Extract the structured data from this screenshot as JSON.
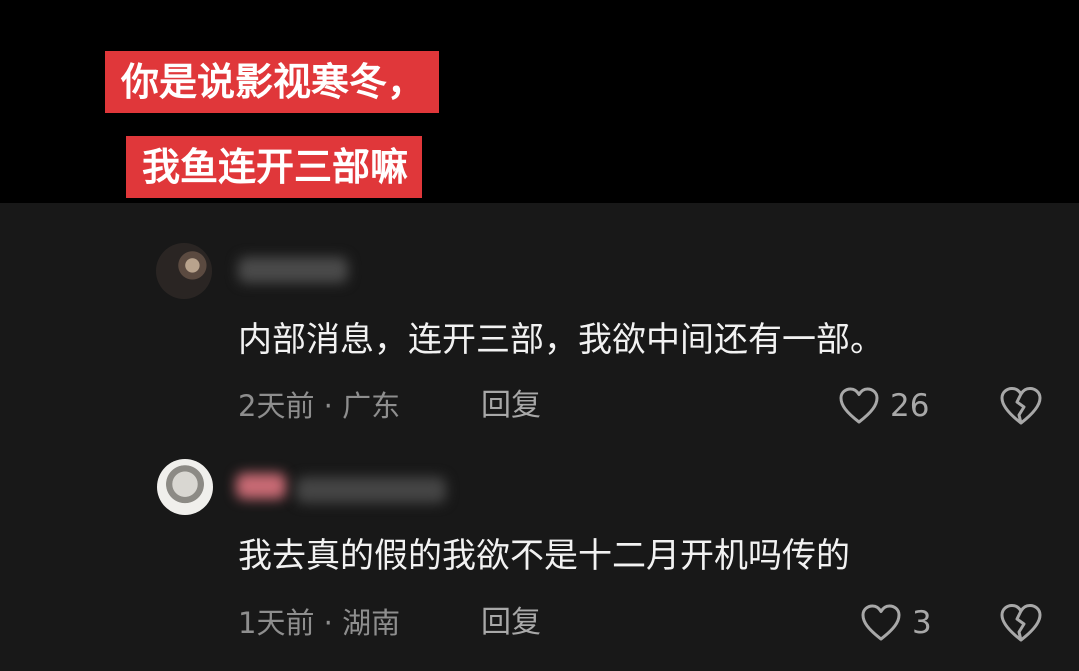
{
  "captions": {
    "line1": "你是说影视寒冬，",
    "line2": "我鱼连开三部嘛"
  },
  "comments": [
    {
      "text": "内部消息，连开三部，我欲中间还有一部。",
      "meta": "2天前 · 广东",
      "reply_label": "回复",
      "likes": "26"
    },
    {
      "text": "我去真的假的我欲不是十二月开机吗传的",
      "meta": "1天前 · 湖南",
      "reply_label": "回复",
      "likes": "3"
    }
  ],
  "colors": {
    "caption_bg": "#e0373a",
    "top_bg": "#000000",
    "comments_bg": "#181818",
    "icon_stroke": "#a8a8a8"
  },
  "icons": {
    "like": "heart-outline-icon",
    "dislike": "broken-heart-icon"
  }
}
